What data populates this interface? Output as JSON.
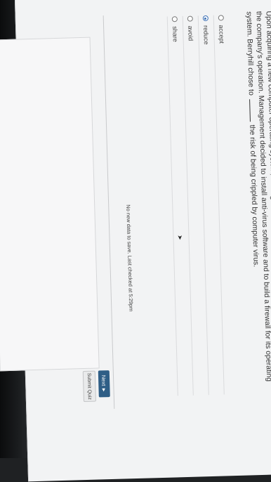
{
  "question": {
    "text_before": "Upon acquiring a new computer operating system, management at Berryhill worried that computer virus might cripple the company's operation. Management decided to install anti-virus software and to build a firewall for its operating system. Berryhill chose to",
    "text_after": "the risk of being crippled by computer virus."
  },
  "options": [
    {
      "label": "accept",
      "selected": false
    },
    {
      "label": "reduce",
      "selected": true
    },
    {
      "label": "avoid",
      "selected": false
    },
    {
      "label": "share",
      "selected": false
    }
  ],
  "status": "No new data to save. Last checked at 5:29pm",
  "buttons": {
    "next": "Next ►",
    "submit": "Submit Quiz"
  },
  "colors": {
    "accent": "#2f5e86",
    "radio_selected": "#3a6fb5"
  }
}
